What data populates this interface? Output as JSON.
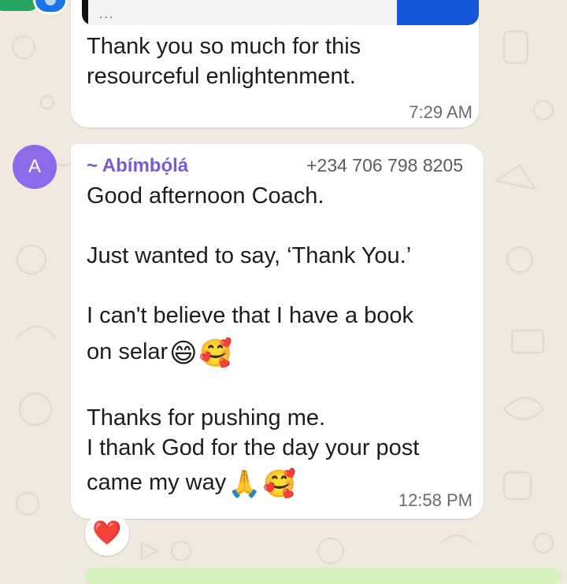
{
  "quoted_message": {
    "preview": "..."
  },
  "message_1": {
    "text": "Thank you so much for this\nresourceful enlightenment.",
    "time": "7:29 AM"
  },
  "message_2": {
    "avatar_letter": "A",
    "sender_name": "~ Abímbọ́lá",
    "sender_phone": "+234 706 798 8205",
    "lines": {
      "l1": "Good afternoon Coach.",
      "l2": "Just wanted to say, ‘Thank You.’",
      "l3": "I can't believe that I have a book",
      "l4": "on selar",
      "l5": "Thanks for pushing me.",
      "l6": "I thank God for the day your post",
      "l7": "came my way"
    },
    "emojis": {
      "grin": "😄",
      "smiling_hearts": "🥰",
      "pray": "🙏"
    },
    "time": "12:58 PM",
    "reaction": "❤️"
  },
  "colors": {
    "background": "#efe9e0",
    "bubble": "#ffffff",
    "sender_name": "#7a5bd6",
    "avatar": "#8b6be8",
    "own_bubble": "#d7f2bf"
  }
}
